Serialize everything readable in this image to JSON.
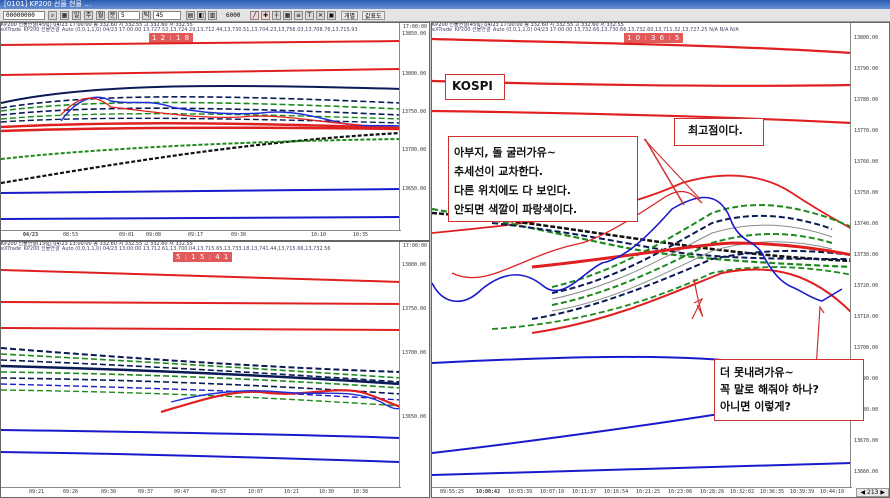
{
  "window": {
    "title": "[0101] KP200 선물 현물 …"
  },
  "toolbar": {
    "code": "00000000",
    "count": "5",
    "period": "45",
    "zoom": "6000",
    "tab1": "개별",
    "tab2": "값표도"
  },
  "panels": {
    "top_left": {
      "header1": "KP200 선물연결(45틱) 04/23 17:00:00 종 332.60 시 332.55 고 332.60 저 332.55",
      "header2": "eXTrade_KP200 선물연결_Auto (0,0,1,1,0) 04/23 17:00:00 13,727.52,13,724.29,13,712.44,13,730.51,13,704.23,13,756.03,13,708.76,13,715.93",
      "badge": "1 2 : 1 8",
      "y_ticks": [
        "13850.00",
        "13800.00",
        "13750.00",
        "13700.00",
        "13650.00"
      ],
      "x_ticks": [
        "04/23",
        "08:53",
        "09:01",
        "09:08",
        "09:17",
        "09:30",
        "10:10",
        "10:35"
      ],
      "corner": "17:00:00"
    },
    "bottom_left": {
      "header1": "KP200 선물연결(15틱) 04/23 13:00:00 종 332.60 시 332.55 고 332.60 저 332.55",
      "header2": "eXTrade_KP200 선물연결_Auto (0,0,1,1,0) 04/23 13:00:00 13,712.61,13,700.04,13,715.65,13,733.18,13,741.44,13,715.66,13,732.56",
      "badge": "5 : 1 5 : 4 1",
      "y_ticks": [
        "13800.00",
        "13750.00",
        "13700.00",
        "13650.00"
      ],
      "x_ticks": [
        "09:21",
        "09:26",
        "09:30",
        "09:37",
        "09:47",
        "09:57",
        "10:07",
        "10:21",
        "10:30",
        "10:38"
      ],
      "corner": "17:00:00"
    },
    "right": {
      "header1": "KP200 선물연결(45틱) 04/23 17:00:00 종 332.60 시 332.55 고 332.60 저 332.55",
      "header2": "eXTrade_KP200 선물연결_Auto (0,0,1,1,0) 04/23 17:00:00 13,732.66,13,730.66,13,732.60,13,711.32,13,727.25 N/A N/A N/A",
      "badge": "1 0 : 3 6 : 5",
      "y_ticks": [
        "13800.00",
        "13790.00",
        "13780.00",
        "13770.00",
        "13760.00",
        "13750.00",
        "13740.00",
        "13730.00",
        "13720.00",
        "13710.00",
        "13700.00",
        "13690.00",
        "13680.00",
        "13670.00",
        "13660.00"
      ],
      "x_ticks": [
        "09:55:25",
        "10:00:42",
        "10:03:39",
        "10:07:10",
        "10:11:37",
        "10:16:54",
        "10:21:25",
        "10:23:06",
        "10:28:26",
        "10:32:02",
        "10:36:35",
        "10:39:39",
        "10:44:10"
      ],
      "corner": "17:00:00",
      "page": "213"
    }
  },
  "notes": {
    "kospi": "KOSPI",
    "note1": [
      "아부지, 돌 굴러가유~",
      "추세선이 교차한다.",
      "다른 위치에도 다 보인다.",
      "안되면 색깔이 파랑색이다."
    ],
    "note2": "최고점이다.",
    "note3": [
      "더 못내려가유~",
      "꼭 말로 해줘야 하나?",
      "아니면 이렇게?"
    ]
  },
  "colors": {
    "red": "#e02020",
    "blue": "#1a1acc",
    "navy": "#0a1a55",
    "green": "#1e8a1e",
    "black": "#111111",
    "annotation_border": "#d03030"
  }
}
